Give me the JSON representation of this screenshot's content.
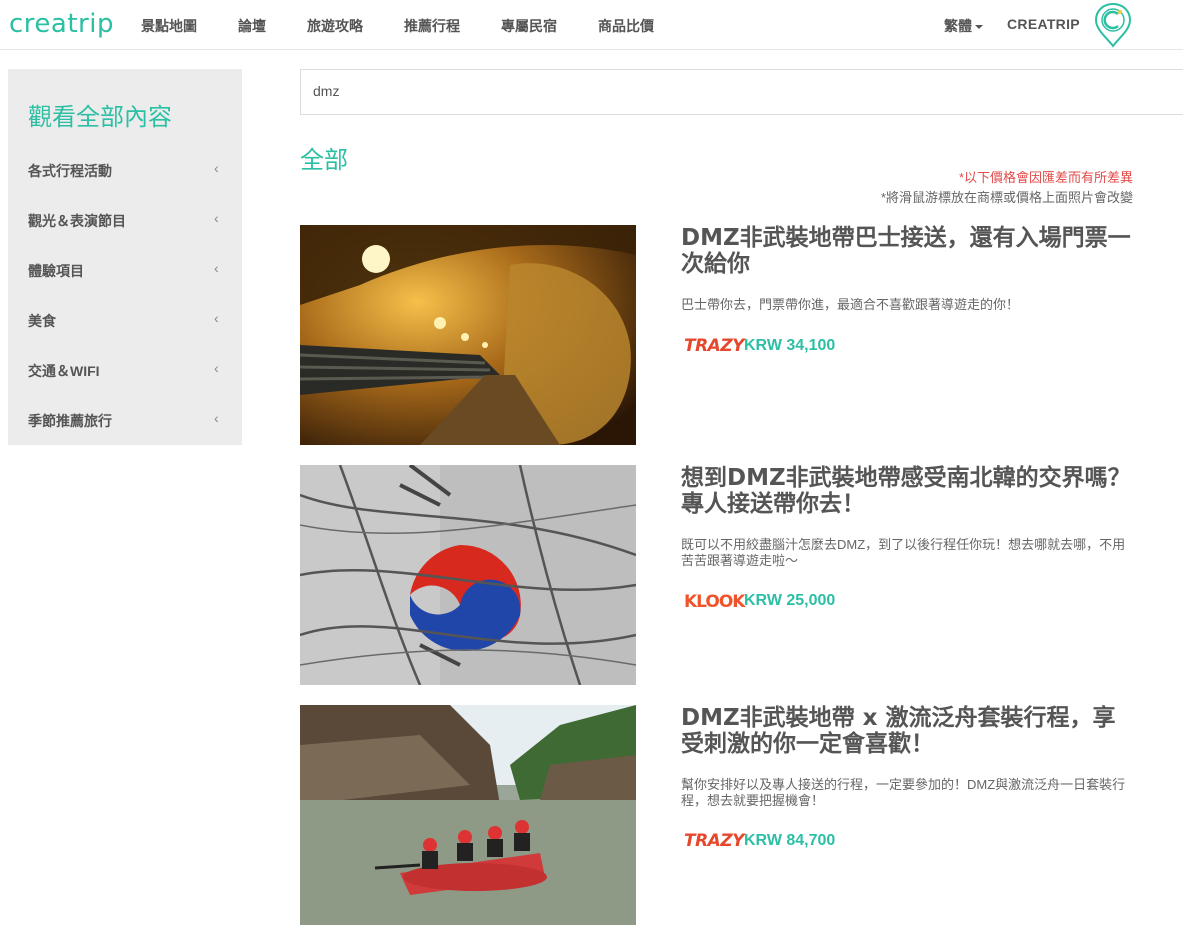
{
  "header": {
    "logo": "creatrip",
    "nav": [
      "景點地圖",
      "論壇",
      "旅遊攻略",
      "推薦行程",
      "專屬民宿",
      "商品比價"
    ],
    "language": "繁體",
    "brand": "CREATRIP",
    "brand_color": "#2bbfa4"
  },
  "sidebar": {
    "title": "觀看全部內容",
    "items": [
      {
        "label": "各式行程活動"
      },
      {
        "label": "觀光＆表演節目"
      },
      {
        "label": "體驗項目"
      },
      {
        "label": "美食"
      },
      {
        "label": "交通＆WIFI"
      },
      {
        "label": "季節推薦旅行"
      }
    ]
  },
  "search": {
    "value": "dmz"
  },
  "main": {
    "section_title": "全部",
    "note_price": "*以下價格會因匯差而有所差異",
    "note_hover": "*將滑鼠游標放在商標或價格上面照片會改變"
  },
  "products": [
    {
      "title": "DMZ非武裝地帶巴士接送，還有入場門票一次給你",
      "desc": "巴士帶你去，門票帶你進，最適合不喜歡跟著導遊走的你！",
      "vendor": "TRAZY",
      "price": "KRW 34,100",
      "image": "tunnel-photo"
    },
    {
      "title": "想到DMZ非武裝地帶感受南北韓的交界嗎？專人接送帶你去！",
      "desc": "既可以不用絞盡腦汁怎麼去DMZ，到了以後行程任你玩！想去哪就去哪，不用苦苦跟著導遊走啦～",
      "vendor": "KLOOK",
      "price": "KRW 25,000",
      "image": "barbed-wire-flag-photo"
    },
    {
      "title": "DMZ非武裝地帶 x 激流泛舟套裝行程，享受刺激的你一定會喜歡！",
      "desc": "幫你安排好以及專人接送的行程，一定要參加的！DMZ與激流泛舟一日套裝行程，想去就要把握機會！",
      "vendor": "TRAZY",
      "price": "KRW 84,700",
      "image": "rafting-photo"
    }
  ]
}
